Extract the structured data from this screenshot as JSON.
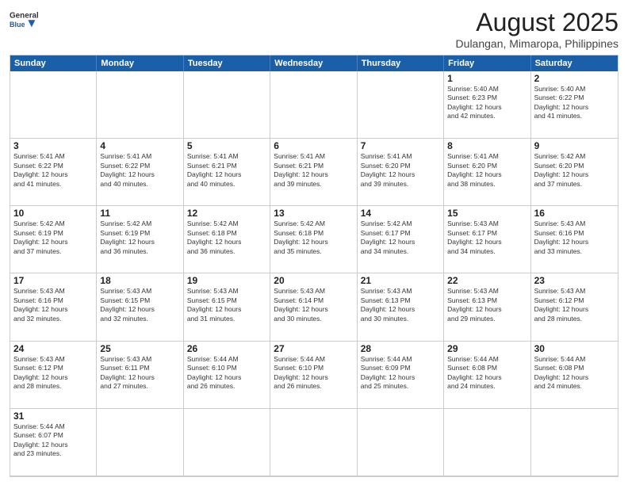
{
  "header": {
    "logo_general": "General",
    "logo_blue": "Blue",
    "month_title": "August 2025",
    "location": "Dulangan, Mimaropa, Philippines"
  },
  "day_headers": [
    "Sunday",
    "Monday",
    "Tuesday",
    "Wednesday",
    "Thursday",
    "Friday",
    "Saturday"
  ],
  "cells": [
    {
      "day": "",
      "info": ""
    },
    {
      "day": "",
      "info": ""
    },
    {
      "day": "",
      "info": ""
    },
    {
      "day": "",
      "info": ""
    },
    {
      "day": "",
      "info": ""
    },
    {
      "day": "1",
      "info": "Sunrise: 5:40 AM\nSunset: 6:23 PM\nDaylight: 12 hours\nand 42 minutes."
    },
    {
      "day": "2",
      "info": "Sunrise: 5:40 AM\nSunset: 6:22 PM\nDaylight: 12 hours\nand 41 minutes."
    },
    {
      "day": "3",
      "info": "Sunrise: 5:41 AM\nSunset: 6:22 PM\nDaylight: 12 hours\nand 41 minutes."
    },
    {
      "day": "4",
      "info": "Sunrise: 5:41 AM\nSunset: 6:22 PM\nDaylight: 12 hours\nand 40 minutes."
    },
    {
      "day": "5",
      "info": "Sunrise: 5:41 AM\nSunset: 6:21 PM\nDaylight: 12 hours\nand 40 minutes."
    },
    {
      "day": "6",
      "info": "Sunrise: 5:41 AM\nSunset: 6:21 PM\nDaylight: 12 hours\nand 39 minutes."
    },
    {
      "day": "7",
      "info": "Sunrise: 5:41 AM\nSunset: 6:20 PM\nDaylight: 12 hours\nand 39 minutes."
    },
    {
      "day": "8",
      "info": "Sunrise: 5:41 AM\nSunset: 6:20 PM\nDaylight: 12 hours\nand 38 minutes."
    },
    {
      "day": "9",
      "info": "Sunrise: 5:42 AM\nSunset: 6:20 PM\nDaylight: 12 hours\nand 37 minutes."
    },
    {
      "day": "10",
      "info": "Sunrise: 5:42 AM\nSunset: 6:19 PM\nDaylight: 12 hours\nand 37 minutes."
    },
    {
      "day": "11",
      "info": "Sunrise: 5:42 AM\nSunset: 6:19 PM\nDaylight: 12 hours\nand 36 minutes."
    },
    {
      "day": "12",
      "info": "Sunrise: 5:42 AM\nSunset: 6:18 PM\nDaylight: 12 hours\nand 36 minutes."
    },
    {
      "day": "13",
      "info": "Sunrise: 5:42 AM\nSunset: 6:18 PM\nDaylight: 12 hours\nand 35 minutes."
    },
    {
      "day": "14",
      "info": "Sunrise: 5:42 AM\nSunset: 6:17 PM\nDaylight: 12 hours\nand 34 minutes."
    },
    {
      "day": "15",
      "info": "Sunrise: 5:43 AM\nSunset: 6:17 PM\nDaylight: 12 hours\nand 34 minutes."
    },
    {
      "day": "16",
      "info": "Sunrise: 5:43 AM\nSunset: 6:16 PM\nDaylight: 12 hours\nand 33 minutes."
    },
    {
      "day": "17",
      "info": "Sunrise: 5:43 AM\nSunset: 6:16 PM\nDaylight: 12 hours\nand 32 minutes."
    },
    {
      "day": "18",
      "info": "Sunrise: 5:43 AM\nSunset: 6:15 PM\nDaylight: 12 hours\nand 32 minutes."
    },
    {
      "day": "19",
      "info": "Sunrise: 5:43 AM\nSunset: 6:15 PM\nDaylight: 12 hours\nand 31 minutes."
    },
    {
      "day": "20",
      "info": "Sunrise: 5:43 AM\nSunset: 6:14 PM\nDaylight: 12 hours\nand 30 minutes."
    },
    {
      "day": "21",
      "info": "Sunrise: 5:43 AM\nSunset: 6:13 PM\nDaylight: 12 hours\nand 30 minutes."
    },
    {
      "day": "22",
      "info": "Sunrise: 5:43 AM\nSunset: 6:13 PM\nDaylight: 12 hours\nand 29 minutes."
    },
    {
      "day": "23",
      "info": "Sunrise: 5:43 AM\nSunset: 6:12 PM\nDaylight: 12 hours\nand 28 minutes."
    },
    {
      "day": "24",
      "info": "Sunrise: 5:43 AM\nSunset: 6:12 PM\nDaylight: 12 hours\nand 28 minutes."
    },
    {
      "day": "25",
      "info": "Sunrise: 5:43 AM\nSunset: 6:11 PM\nDaylight: 12 hours\nand 27 minutes."
    },
    {
      "day": "26",
      "info": "Sunrise: 5:44 AM\nSunset: 6:10 PM\nDaylight: 12 hours\nand 26 minutes."
    },
    {
      "day": "27",
      "info": "Sunrise: 5:44 AM\nSunset: 6:10 PM\nDaylight: 12 hours\nand 26 minutes."
    },
    {
      "day": "28",
      "info": "Sunrise: 5:44 AM\nSunset: 6:09 PM\nDaylight: 12 hours\nand 25 minutes."
    },
    {
      "day": "29",
      "info": "Sunrise: 5:44 AM\nSunset: 6:08 PM\nDaylight: 12 hours\nand 24 minutes."
    },
    {
      "day": "30",
      "info": "Sunrise: 5:44 AM\nSunset: 6:08 PM\nDaylight: 12 hours\nand 24 minutes."
    },
    {
      "day": "31",
      "info": "Sunrise: 5:44 AM\nSunset: 6:07 PM\nDaylight: 12 hours\nand 23 minutes."
    },
    {
      "day": "",
      "info": ""
    },
    {
      "day": "",
      "info": ""
    },
    {
      "day": "",
      "info": ""
    },
    {
      "day": "",
      "info": ""
    },
    {
      "day": "",
      "info": ""
    },
    {
      "day": "",
      "info": ""
    }
  ]
}
